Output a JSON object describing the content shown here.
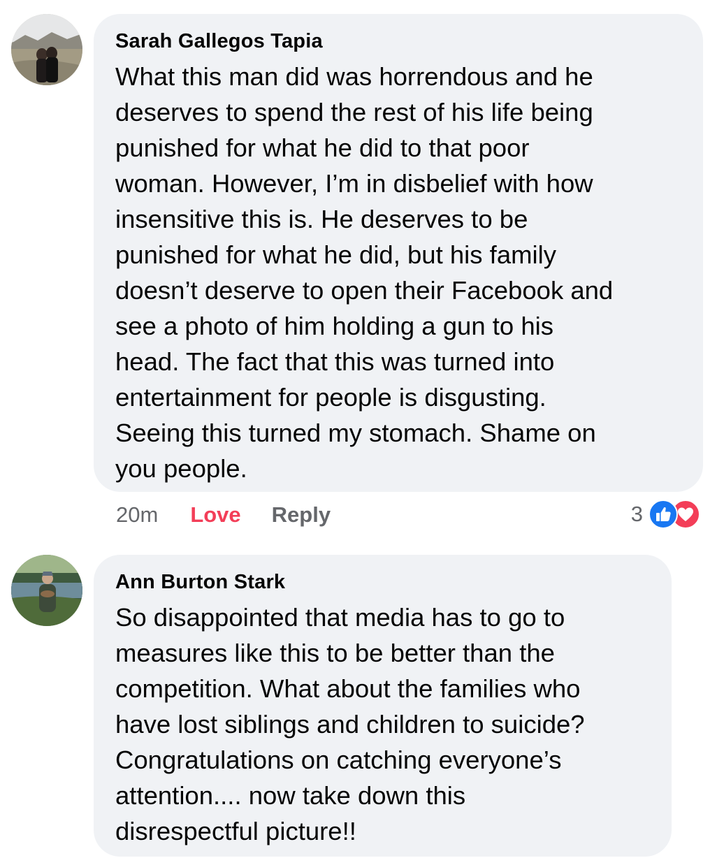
{
  "comments": [
    {
      "author": "Sarah Gallegos Tapia",
      "text": "What this man did was horrendous and he\ndeserves to spend the rest of his life being\npunished for what he did to that poor\nwoman. However, I’m in disbelief with how\ninsensitive this is. He deserves to be\npunished for what he did, but his family\ndoesn’t deserve to open their Facebook and\nsee a photo of him holding a gun to his\nhead. The fact that this was turned into\nentertainment for people is disgusting.\nSeeing this turned my stomach. Shame on\nyou people.",
      "time": "20m",
      "love_label": "Love",
      "reply_label": "Reply",
      "reaction_count": "3",
      "reaction_icons": [
        "like-icon",
        "love-icon"
      ],
      "love_active_color": "#f33e58"
    },
    {
      "author": "Ann Burton Stark",
      "text": "So disappointed that media has to go to\nmeasures like this to be better than the\ncompetition. What about the families who\nhave lost siblings and children to suicide?\nCongratulations on catching everyone’s\nattention.... now take down this\ndisrespectful picture!!"
    }
  ],
  "colors": {
    "bubble_bg": "#f0f2f5",
    "secondary_text": "#65676b",
    "like_blue": "#1877f2",
    "love_red": "#f33e58"
  }
}
